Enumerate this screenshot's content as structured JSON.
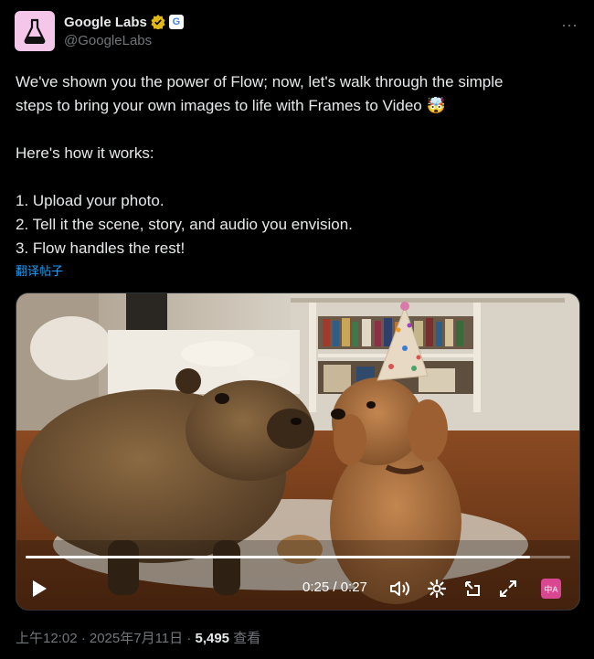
{
  "header": {
    "display_name": "Google Labs",
    "handle": "@GoogleLabs",
    "g_badge": "G",
    "more_icon": "···"
  },
  "tweet": {
    "line1": "We've shown you the power of Flow; now, let's walk through the simple",
    "line2": "steps to bring your own images to life with Frames to Video 🤯",
    "line3": "Here's how it works:",
    "step1": "1. Upload your photo.",
    "step2": "2. Tell it the scene, story, and audio you envision.",
    "step3": "3. Flow handles the rest!"
  },
  "translate_label": "翻译帖子",
  "video": {
    "time": "0:25 / 0:27",
    "progress": 0.926,
    "translate_icon_label": "中A"
  },
  "footer": {
    "timestamp": "上午12:02 · 2025年7月11日 · ",
    "views": "5,495",
    "views_label": " 查看"
  },
  "colors": {
    "accent": "#1d9bf0",
    "avatar_bg": "#f4c6ea",
    "verified": "#e2b719"
  }
}
